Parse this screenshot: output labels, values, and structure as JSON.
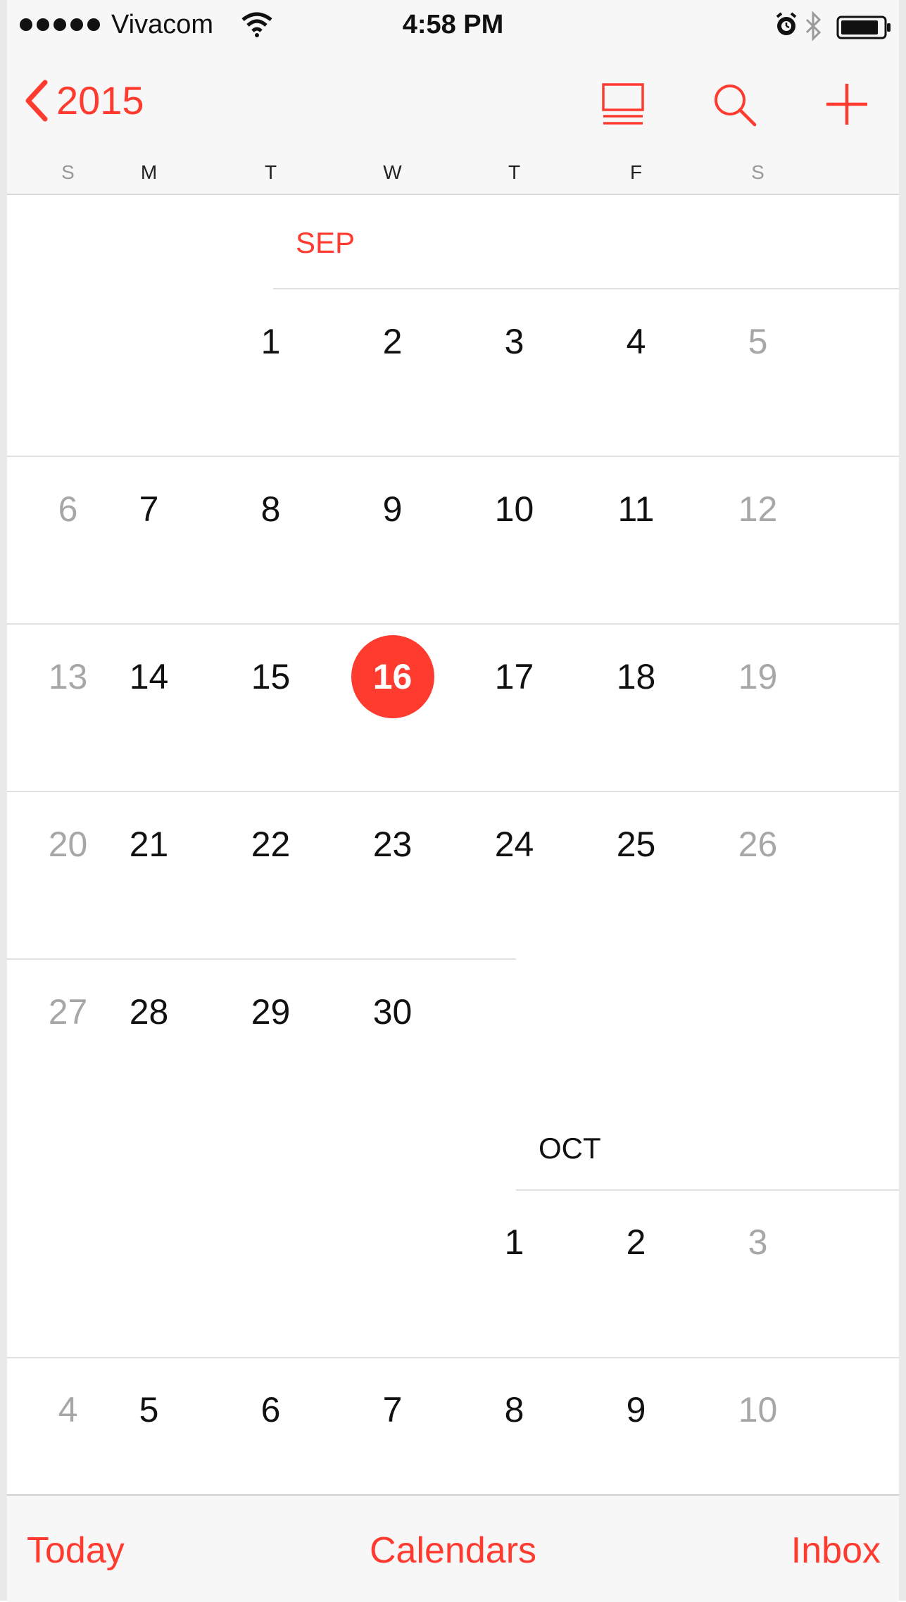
{
  "status_bar": {
    "carrier": "Vivacom",
    "time": "4:58 PM"
  },
  "nav": {
    "back_label": "2015"
  },
  "weekdays": [
    "S",
    "M",
    "T",
    "W",
    "T",
    "F",
    "S"
  ],
  "months": {
    "sep": "SEP",
    "oct": "OCT"
  },
  "sep_weeks": [
    [
      "",
      "",
      "1",
      "2",
      "3",
      "4",
      "5"
    ],
    [
      "6",
      "7",
      "8",
      "9",
      "10",
      "11",
      "12"
    ],
    [
      "13",
      "14",
      "15",
      "16",
      "17",
      "18",
      "19"
    ],
    [
      "20",
      "21",
      "22",
      "23",
      "24",
      "25",
      "26"
    ],
    [
      "27",
      "28",
      "29",
      "30",
      "",
      "",
      ""
    ]
  ],
  "oct_weeks": [
    [
      "",
      "",
      "",
      "",
      "1",
      "2",
      "3"
    ],
    [
      "4",
      "5",
      "6",
      "7",
      "8",
      "9",
      "10"
    ]
  ],
  "today": "16",
  "toolbar": {
    "today": "Today",
    "calendars": "Calendars",
    "inbox": "Inbox"
  },
  "colors": {
    "accent": "#ff3b30",
    "weekend_text": "#a7a7a7"
  }
}
